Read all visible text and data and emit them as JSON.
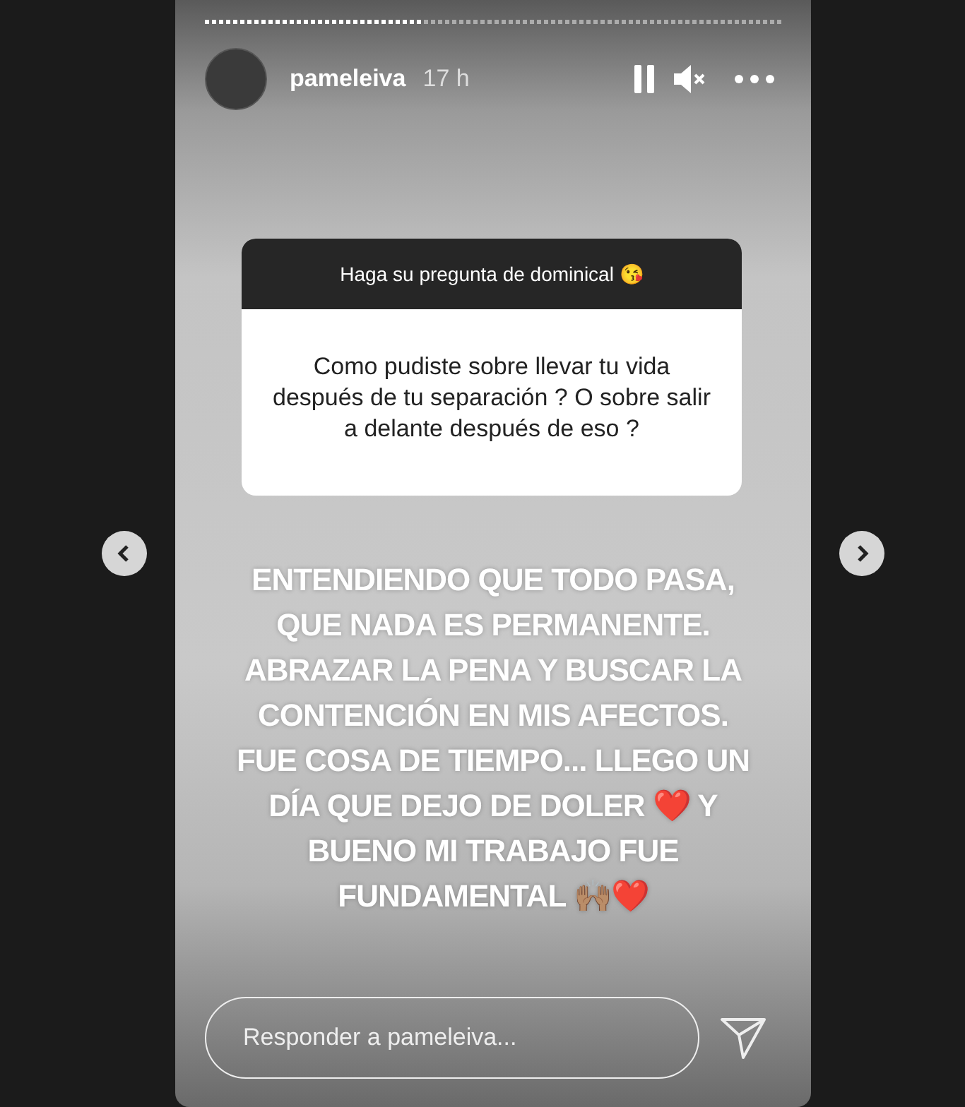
{
  "progress": {
    "level": 0.375
  },
  "header": {
    "username": "pameleiva",
    "time": "17 h"
  },
  "question": {
    "title": "Haga su pregunta de dominical 😘",
    "text": "Como pudiste sobre llevar tu vida después de tu separación ? O sobre salir a delante después de eso ?"
  },
  "answer": "ENTENDIENDO QUE TODO PASA, QUE NADA ES PERMANENTE. ABRAZAR LA PENA Y BUSCAR LA CONTENCIÓN EN MIS AFECTOS. FUE COSA DE TIEMPO... LLEGO UN DÍA QUE DEJO DE DOLER ❤️ Y BUENO MI TRABAJO FUE FUNDAMENTAL 🙌🏽❤️",
  "reply": {
    "placeholder": "Responder a pameleiva..."
  }
}
